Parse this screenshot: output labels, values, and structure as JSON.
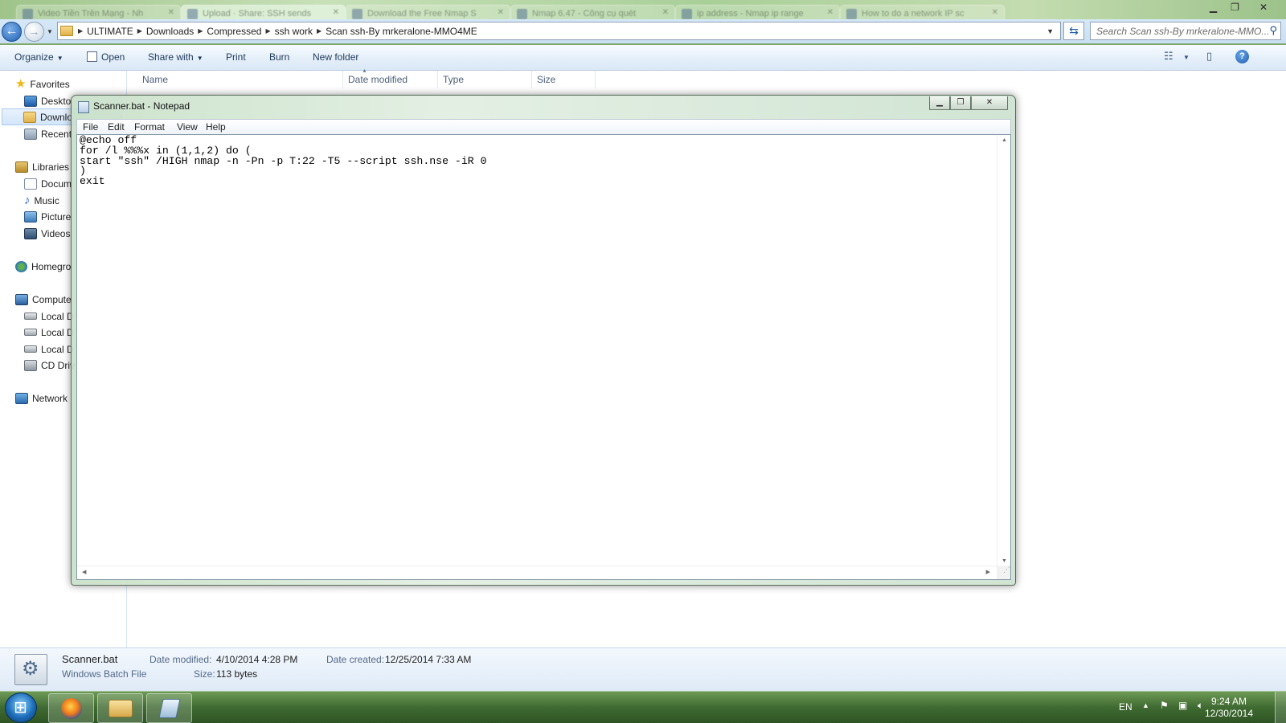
{
  "browser_tabs": [
    {
      "label": "Video Tiền Trên Mạng - Nh"
    },
    {
      "label": "Upload · Share: SSH sends"
    },
    {
      "label": "Download the Free Nmap S"
    },
    {
      "label": "Nmap 6.47 - Công cụ quét"
    },
    {
      "label": "ip address - Nmap ip range"
    },
    {
      "label": "How to do a network IP sc"
    }
  ],
  "address_bar": {
    "crumbs": [
      "ULTIMATE",
      "Downloads",
      "Compressed",
      "ssh work",
      "Scan ssh-By mrkeralone-MMO4ME"
    ],
    "search_placeholder": "Search Scan ssh-By mrkeralone-MMO..."
  },
  "toolbar": {
    "organize": "Organize",
    "open": "Open",
    "share_with": "Share with",
    "print": "Print",
    "burn": "Burn",
    "new_folder": "New folder"
  },
  "nav": {
    "favorites": "Favorites",
    "desktop": "Deskto",
    "downloads": "Downlo",
    "recent": "Recent",
    "libraries": "Libraries",
    "documents": "Docum",
    "music": "Music",
    "pictures": "Picture",
    "videos": "Videos",
    "homegroup": "Homegro",
    "computer": "Compute",
    "local_disk_1": "Local D",
    "local_disk_2": "Local D",
    "local_disk_3": "Local D",
    "cd_drive": "CD Driv",
    "network": "Network"
  },
  "columns": {
    "name": "Name",
    "date_modified": "Date modified",
    "type": "Type",
    "size": "Size"
  },
  "notepad": {
    "title": "Scanner.bat - Notepad",
    "menus": [
      "File",
      "Edit",
      "Format",
      "View",
      "Help"
    ],
    "content": "@echo off\nfor /l %%%x in (1,1,2) do (\nstart \"ssh\" /HIGH nmap -n -Pn -p T:22 -T5 --script ssh.nse -iR 0\n)\nexit"
  },
  "details": {
    "file_name": "Scanner.bat",
    "file_type": "Windows Batch File",
    "date_modified_label": "Date modified:",
    "date_modified": "4/10/2014 4:28 PM",
    "size_label": "Size:",
    "size": "113 bytes",
    "date_created_label": "Date created:",
    "date_created": "12/25/2014 7:33 AM"
  },
  "taskbar": {
    "language": "EN",
    "time": "9:24 AM",
    "date": "12/30/2014"
  }
}
